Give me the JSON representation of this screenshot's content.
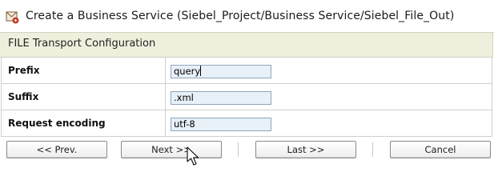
{
  "window": {
    "title": "Create a Business Service (Siebel_Project/Business Service/Siebel_File_Out)",
    "icon": "business-service-icon"
  },
  "section": {
    "title": "FILE Transport Configuration"
  },
  "fields": [
    {
      "label": "Prefix",
      "value": "query"
    },
    {
      "label": "Suffix",
      "value": ".xml"
    },
    {
      "label": "Request encoding",
      "value": "utf-8"
    }
  ],
  "buttons": {
    "prev": "<< Prev.",
    "next": "Next >>",
    "last": "Last >>",
    "cancel": "Cancel"
  },
  "colors": {
    "section_bg": "#efefdd",
    "input_bg": "#e8f0f8",
    "input_border": "#8fa6bd"
  }
}
